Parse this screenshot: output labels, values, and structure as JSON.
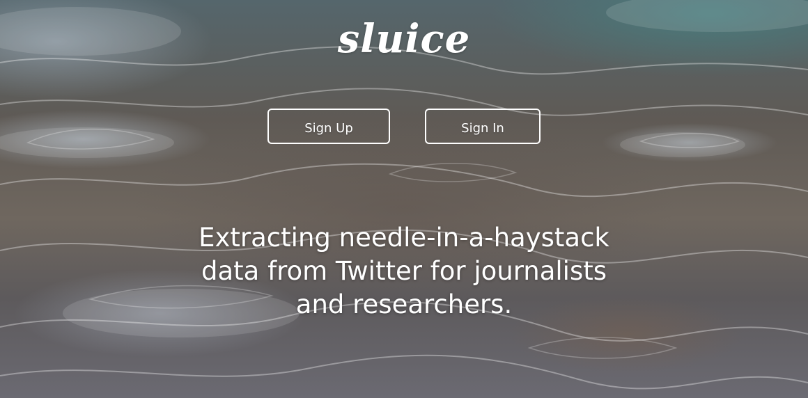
{
  "brand": {
    "logo_text": "sluice"
  },
  "actions": {
    "sign_up_label": "Sign Up",
    "sign_in_label": "Sign In"
  },
  "hero": {
    "tagline_line1": "Extracting needle-in-a-haystack",
    "tagline_line2": "data from Twitter for journalists",
    "tagline_line3": "and researchers."
  },
  "colors": {
    "text": "#ffffff",
    "button_border": "#ffffff"
  }
}
